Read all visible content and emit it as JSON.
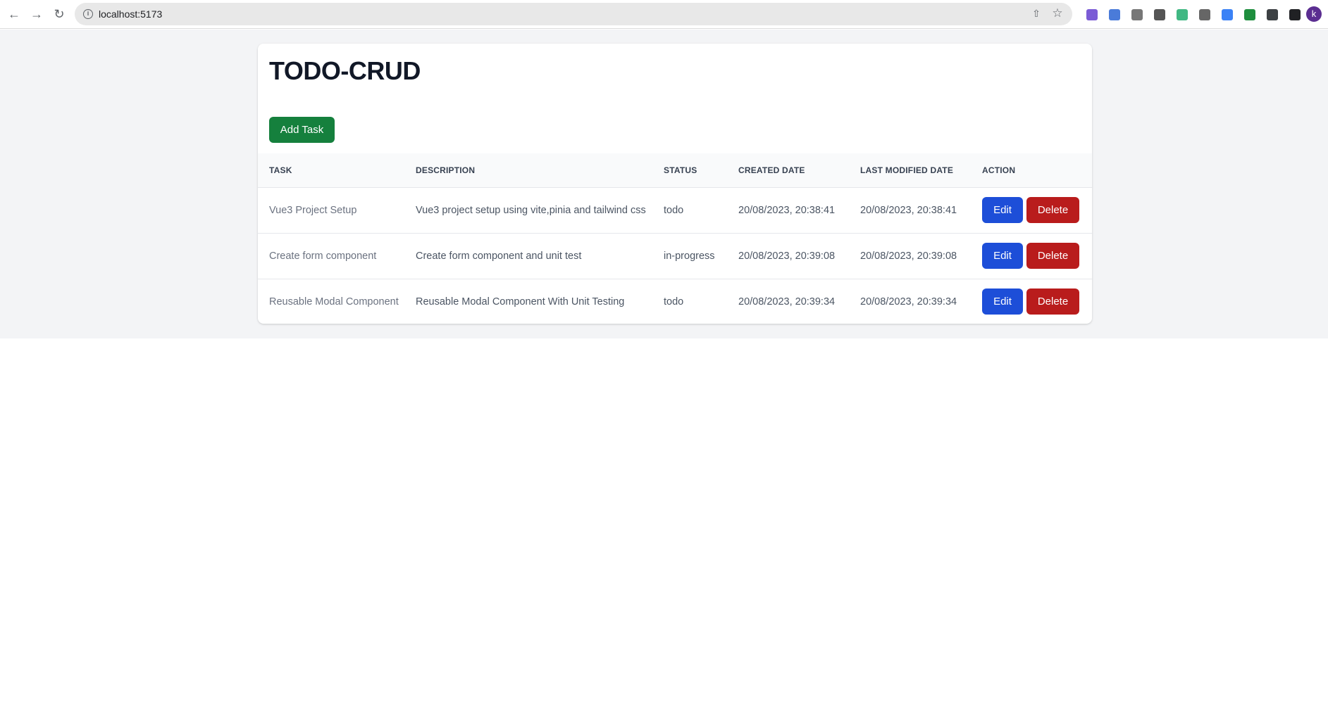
{
  "browser": {
    "url": "localhost:5173",
    "avatar_letter": "k",
    "extensions": [
      {
        "name": "ext-1-icon",
        "color": "#7b5cd6"
      },
      {
        "name": "translate-ext-icon",
        "color": "#4a7bd9"
      },
      {
        "name": "ext-3-icon",
        "color": "#777777"
      },
      {
        "name": "chart-ext-icon",
        "color": "#555555"
      },
      {
        "name": "vue-devtools-icon",
        "color": "#41b883"
      },
      {
        "name": "ext-6-icon",
        "color": "#666666"
      },
      {
        "name": "ext-7-icon",
        "color": "#3b82f6"
      },
      {
        "name": "ext-8-icon",
        "color": "#1e8e3e"
      },
      {
        "name": "puzzle-ext-icon",
        "color": "#3c4043"
      },
      {
        "name": "sidepanel-icon",
        "color": "#202124"
      }
    ]
  },
  "app": {
    "title": "TODO-CRUD",
    "add_task_label": "Add Task",
    "columns": {
      "task": "TASK",
      "description": "DESCRIPTION",
      "status": "STATUS",
      "created": "CREATED DATE",
      "modified": "LAST MODIFIED DATE",
      "action": "ACTION"
    },
    "edit_label": "Edit",
    "delete_label": "Delete",
    "rows": [
      {
        "task": "Vue3 Project Setup",
        "description": "Vue3 project setup using vite,pinia and tailwind css",
        "status": "todo",
        "created": "20/08/2023, 20:38:41",
        "modified": "20/08/2023, 20:38:41"
      },
      {
        "task": "Create form component",
        "description": "Create form component and unit test",
        "status": "in-progress",
        "created": "20/08/2023, 20:39:08",
        "modified": "20/08/2023, 20:39:08"
      },
      {
        "task": "Reusable Modal Component",
        "description": "Reusable Modal Component With Unit Testing",
        "status": "todo",
        "created": "20/08/2023, 20:39:34",
        "modified": "20/08/2023, 20:39:34"
      }
    ]
  }
}
